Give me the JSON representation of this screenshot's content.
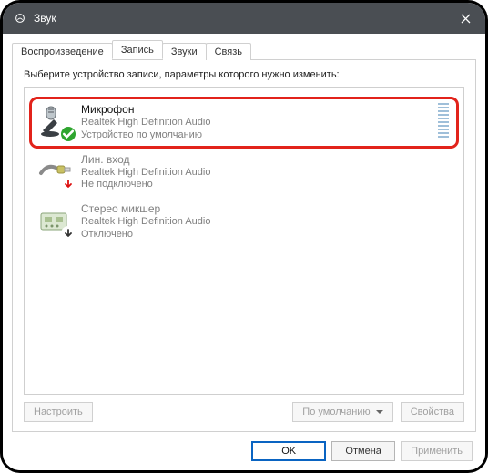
{
  "window": {
    "title": "Звук",
    "close_label": "Close"
  },
  "tabs": {
    "items": [
      {
        "label": "Воспроизведение"
      },
      {
        "label": "Запись"
      },
      {
        "label": "Звуки"
      },
      {
        "label": "Связь"
      }
    ],
    "active_index": 1
  },
  "instruction": "Выберите устройство записи, параметры которого нужно изменить:",
  "devices": [
    {
      "name": "Микрофон",
      "driver": "Realtek High Definition Audio",
      "status": "Устройство по умолчанию",
      "icon": "microphone-icon",
      "badge": "check",
      "selected": true,
      "grayed": false,
      "level_bars": 10
    },
    {
      "name": "Лин. вход",
      "driver": "Realtek High Definition Audio",
      "status": "Не подключено",
      "icon": "line-in-icon",
      "badge": "down-red",
      "selected": false,
      "grayed": true,
      "level_bars": 0
    },
    {
      "name": "Стерео микшер",
      "driver": "Realtek High Definition Audio",
      "status": "Отключено",
      "icon": "mixer-icon",
      "badge": "down-black",
      "selected": false,
      "grayed": true,
      "level_bars": 0
    }
  ],
  "buttons": {
    "configure": "Настроить",
    "set_default": "По умолчанию",
    "properties": "Свойства",
    "ok": "OK",
    "cancel": "Отмена",
    "apply": "Применить"
  },
  "colors": {
    "highlight": "#e2231b",
    "ok_border": "#0a64c2"
  }
}
